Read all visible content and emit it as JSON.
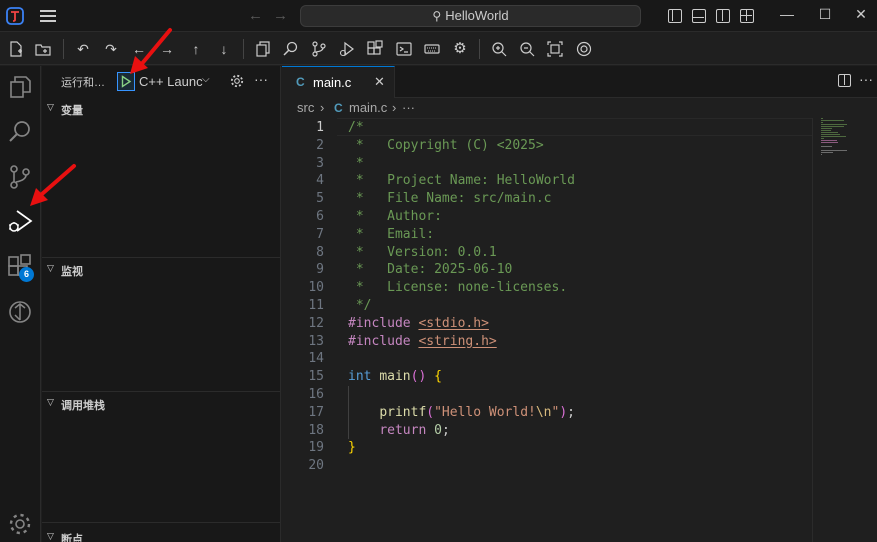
{
  "window": {
    "search_text": "HelloWorld",
    "controls": [
      "minimize",
      "maximize",
      "close"
    ]
  },
  "sidebar": {
    "title": "运行和…",
    "config_name": "C++ Launc",
    "sections": [
      {
        "label": "变量"
      },
      {
        "label": "监视"
      },
      {
        "label": "调用堆栈"
      },
      {
        "label": "断点"
      }
    ]
  },
  "activity": {
    "extensions_badge": "6"
  },
  "editor": {
    "tab_name": "main.c",
    "breadcrumb": [
      "src",
      "main.c",
      "···"
    ],
    "active_line": 1
  },
  "code": [
    {
      "n": "1",
      "t": "/*"
    },
    {
      "n": "2",
      "t": " *   Copyright (C) <2025>"
    },
    {
      "n": "3",
      "t": " *"
    },
    {
      "n": "4",
      "t": " *   Project Name: HelloWorld"
    },
    {
      "n": "5",
      "t": " *   File Name: src/main.c"
    },
    {
      "n": "6",
      "t": " *   Author:"
    },
    {
      "n": "7",
      "t": " *   Email:"
    },
    {
      "n": "8",
      "t": " *   Version: 0.0.1"
    },
    {
      "n": "9",
      "t": " *   Date: 2025-06-10"
    },
    {
      "n": "10",
      "t": " *   License: none-licenses."
    },
    {
      "n": "11",
      "t": " */"
    },
    {
      "n": "12",
      "t": "#include <stdio.h>"
    },
    {
      "n": "13",
      "t": "#include <string.h>"
    },
    {
      "n": "14",
      "t": ""
    },
    {
      "n": "15",
      "t": "int main() {"
    },
    {
      "n": "16",
      "t": ""
    },
    {
      "n": "17",
      "t": "    printf(\"Hello World!\\n\");"
    },
    {
      "n": "18",
      "t": "    return 0;"
    },
    {
      "n": "19",
      "t": "}"
    },
    {
      "n": "20",
      "t": ""
    }
  ],
  "colors": {
    "accent": "#0078d4",
    "annotation_arrow": "#e81010",
    "comment": "#6a9955",
    "keyword": "#569cd6"
  }
}
